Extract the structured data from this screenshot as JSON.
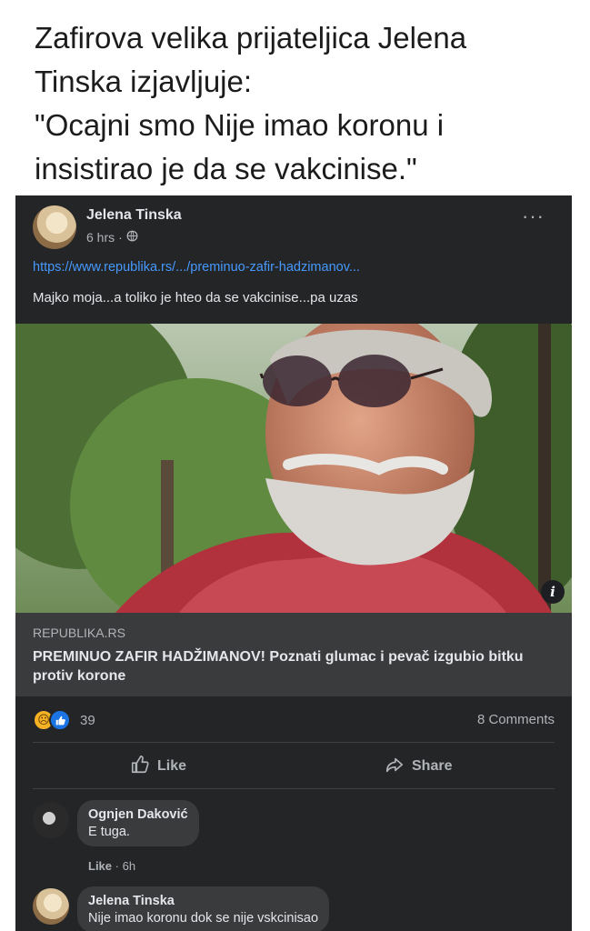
{
  "caption": {
    "lines": [
      "Zafirova velika prijateljica Jelena",
      "Tinska izjavljuje:",
      "\"Ocajni smo Nije imao koronu i",
      "insistirao je da se vakcinise.\""
    ]
  },
  "post": {
    "author": "Jelena Tinska",
    "time": "6 hrs",
    "privacy_icon": "globe-icon",
    "more_icon": "more-options-icon",
    "link_text": "https://www.republika.rs/.../preminuo-zafir-hadzimanov...",
    "text": "Majko moja...a toliko je hteo da se vakcinise...pa uzas",
    "preview": {
      "domain": "REPUBLIKA.RS",
      "headline": "PREMINUO ZAFIR HADŽIMANOV! Poznati glumac i pevač izgubio bitku protiv korone"
    },
    "reactions": {
      "count": "39",
      "types": [
        "sad",
        "like"
      ]
    },
    "comments_count": "8 Comments",
    "actions": {
      "like_label": "Like",
      "share_label": "Share"
    }
  },
  "comments": [
    {
      "author": "Ognjen Daković",
      "text": "E tuga.",
      "like_label": "Like",
      "time": "6h"
    },
    {
      "author": "Jelena Tinska",
      "text": "Nije imao koronu dok se nije vskcinisao"
    }
  ],
  "colors": {
    "background": "#242526",
    "card": "#3a3b3c",
    "link": "#4599ff",
    "text": "#e4e6eb",
    "secondary": "#b0b3b8"
  }
}
